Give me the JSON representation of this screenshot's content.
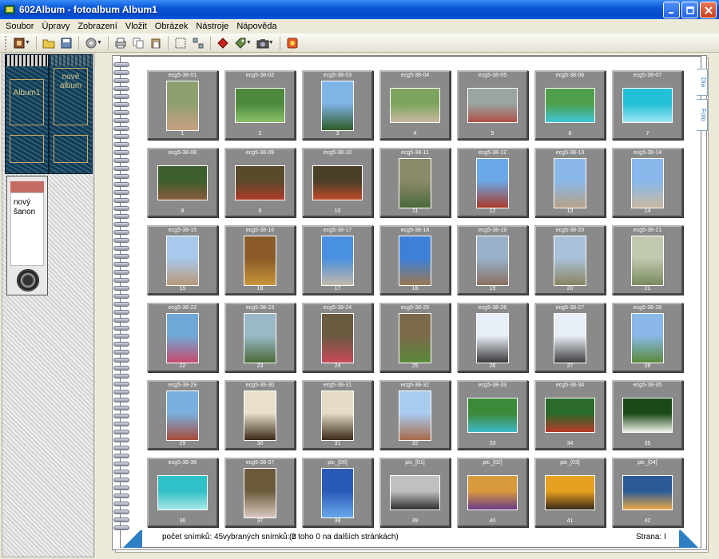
{
  "window": {
    "title": "602Album - fotoalbum Album1"
  },
  "menu": [
    "Soubor",
    "Úpravy",
    "Zobrazení",
    "Vložit",
    "Obrázek",
    "Nástroje",
    "Nápověda"
  ],
  "binders": [
    {
      "label": "Album1"
    },
    {
      "label": "nové album"
    }
  ],
  "new_binder_label": "nový šanon",
  "side_tabs": [
    "Dia",
    "Foto"
  ],
  "slides": [
    {
      "name": "ecg5-38-01",
      "num": "1",
      "c": [
        "#8fa070",
        "#c9a080"
      ],
      "o": "p"
    },
    {
      "name": "ecg5-38-02",
      "num": "2",
      "c": [
        "#4d8a3e",
        "#8ec06a"
      ],
      "o": "l"
    },
    {
      "name": "ecg5-38-03",
      "num": "3",
      "c": [
        "#7fb4e6",
        "#2f5a28"
      ],
      "o": "p"
    },
    {
      "name": "ecg5-38-04",
      "num": "4",
      "c": [
        "#7da45c",
        "#c8b8a0"
      ],
      "o": "l"
    },
    {
      "name": "ecg5-38-05",
      "num": "5",
      "c": [
        "#9aa4a0",
        "#b04f48"
      ],
      "o": "l"
    },
    {
      "name": "ecg5-38-06",
      "num": "6",
      "c": [
        "#4ea04a",
        "#3fc6d8"
      ],
      "o": "l"
    },
    {
      "name": "ecg5-38-07",
      "num": "7",
      "c": [
        "#24c0d8",
        "#9ee6f2"
      ],
      "o": "l"
    },
    {
      "name": "ecg5-38-08",
      "num": "8",
      "c": [
        "#3d5f2c",
        "#8a5a3a"
      ],
      "o": "l"
    },
    {
      "name": "ecg5-38-09",
      "num": "9",
      "c": [
        "#5a4a2c",
        "#b03a2a"
      ],
      "o": "l"
    },
    {
      "name": "ecg5-38-10",
      "num": "10",
      "c": [
        "#4a4028",
        "#c04a2a"
      ],
      "o": "l"
    },
    {
      "name": "ecg5-38-11",
      "num": "11",
      "c": [
        "#8a8a6a",
        "#4a6a3a"
      ],
      "o": "p"
    },
    {
      "name": "ecg5-38-12",
      "num": "12",
      "c": [
        "#6aa8e8",
        "#a83a2a"
      ],
      "o": "p"
    },
    {
      "name": "ecg5-38-13",
      "num": "13",
      "c": [
        "#8ab8e8",
        "#b8a088"
      ],
      "o": "p"
    },
    {
      "name": "ecg5-38-14",
      "num": "14",
      "c": [
        "#88b8ec",
        "#c8b8a0"
      ],
      "o": "p"
    },
    {
      "name": "ecg5-38-15",
      "num": "15",
      "c": [
        "#a8c8ec",
        "#b89878"
      ],
      "o": "p"
    },
    {
      "name": "ecg5-38-16",
      "num": "16",
      "c": [
        "#8a5a28",
        "#c8963a"
      ],
      "o": "p"
    },
    {
      "name": "ecg5-38-17",
      "num": "17",
      "c": [
        "#4a90e0",
        "#c0b8a8"
      ],
      "o": "p"
    },
    {
      "name": "ecg5-38-18",
      "num": "18",
      "c": [
        "#3c80d8",
        "#9a7850"
      ],
      "o": "p"
    },
    {
      "name": "ecg5-38-19",
      "num": "19",
      "c": [
        "#98b0c8",
        "#8a7060"
      ],
      "o": "p"
    },
    {
      "name": "ecg5-38-20",
      "num": "20",
      "c": [
        "#a8c0d8",
        "#8a8460"
      ],
      "o": "p"
    },
    {
      "name": "ecg5-38-21",
      "num": "21",
      "c": [
        "#c0c8b0",
        "#7a8a60"
      ],
      "o": "p"
    },
    {
      "name": "ecg5-38-22",
      "num": "22",
      "c": [
        "#70a8d8",
        "#c84a6a"
      ],
      "o": "p"
    },
    {
      "name": "ecg5-38-23",
      "num": "23",
      "c": [
        "#9ab8c8",
        "#4a6a38"
      ],
      "o": "p"
    },
    {
      "name": "ecg5-38-24",
      "num": "24",
      "c": [
        "#6a5a40",
        "#c84a5a"
      ],
      "o": "p"
    },
    {
      "name": "ecg5-38-25",
      "num": "25",
      "c": [
        "#7a6a4a",
        "#5a8a3a"
      ],
      "o": "p"
    },
    {
      "name": "ecg5-38-26",
      "num": "26",
      "c": [
        "#e8eef6",
        "#3a3a3a"
      ],
      "o": "p"
    },
    {
      "name": "ecg5-38-27",
      "num": "27",
      "c": [
        "#e8eef6",
        "#404040"
      ],
      "o": "p"
    },
    {
      "name": "ecg5-38-28",
      "num": "28",
      "c": [
        "#8ab8e8",
        "#5a8a3a"
      ],
      "o": "p"
    },
    {
      "name": "ecg5-38-29",
      "num": "29",
      "c": [
        "#7ab0e0",
        "#a84a3a"
      ],
      "o": "p"
    },
    {
      "name": "ecg5-38-30",
      "num": "30",
      "c": [
        "#e8e0c8",
        "#3a2a1a"
      ],
      "o": "p"
    },
    {
      "name": "ecg5-38-31",
      "num": "31",
      "c": [
        "#e4dcc4",
        "#3a2a1a"
      ],
      "o": "p"
    },
    {
      "name": "ecg5-38-32",
      "num": "32",
      "c": [
        "#a8ccf0",
        "#a86a4a"
      ],
      "o": "p"
    },
    {
      "name": "ecg5-38-33",
      "num": "33",
      "c": [
        "#3a8a3a",
        "#40b8c8"
      ],
      "o": "l"
    },
    {
      "name": "ecg5-38-34",
      "num": "34",
      "c": [
        "#2a6a2a",
        "#b83a2a"
      ],
      "o": "l"
    },
    {
      "name": "ecg5-38-35",
      "num": "35",
      "c": [
        "#1a4a1a",
        "#f0f0e8"
      ],
      "o": "l"
    },
    {
      "name": "ecg5-38-36",
      "num": "36",
      "c": [
        "#30c0c8",
        "#a8e8e8"
      ],
      "o": "l"
    },
    {
      "name": "ecg5-38-37",
      "num": "37",
      "c": [
        "#6a5a3a",
        "#d8c8c0"
      ],
      "o": "p"
    },
    {
      "name": "pic_[00]",
      "num": "38",
      "c": [
        "#2a5ab8",
        "#68a8e8"
      ],
      "o": "p"
    },
    {
      "name": "pic_[01]",
      "num": "39",
      "c": [
        "#c0c0c0",
        "#303030"
      ],
      "o": "l"
    },
    {
      "name": "pic_[02]",
      "num": "40",
      "c": [
        "#d89a3a",
        "#6a3a8a"
      ],
      "o": "l"
    },
    {
      "name": "pic_[03]",
      "num": "41",
      "c": [
        "#e8a020",
        "#3a2a18"
      ],
      "o": "l"
    },
    {
      "name": "pic_[04]",
      "num": "42",
      "c": [
        "#2a5a98",
        "#e8a848"
      ],
      "o": "l"
    }
  ],
  "status": {
    "count": "počet snímků: 45",
    "selected": "vybraných snímků: 0",
    "other_pages": "(z toho 0 na dalších stránkách)",
    "page": "Strana: I"
  }
}
